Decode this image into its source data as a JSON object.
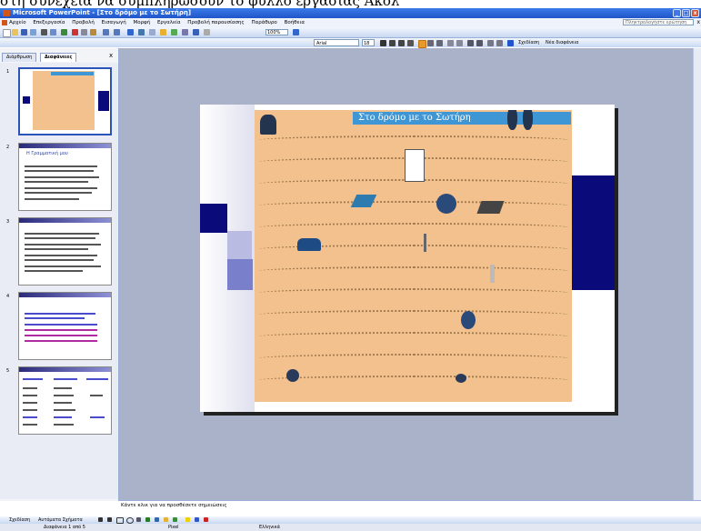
{
  "caption_text": "στη συνέχεια να συμπληρώσουν το φύλλο εργασίας Ακολ",
  "window": {
    "title": "Microsoft PowerPoint - [Στο δρόμο με το Σωτήρη]",
    "min": "_",
    "max": "□",
    "close": "x"
  },
  "menu": {
    "items": [
      "Αρχείο",
      "Επεξεργασία",
      "Προβολή",
      "Εισαγωγή",
      "Μορφή",
      "Εργαλεία",
      "Προβολή παρουσίασης",
      "Παράθυρο",
      "Βοήθεια"
    ],
    "help_placeholder": "Πληκτρολογήστε ερώτηση",
    "close_doc": "x"
  },
  "toolbar": {
    "zoom": "100%",
    "font": "Arial",
    "font_size": "18",
    "design_label": "Σχεδίαση",
    "new_slide_label": "Νέα διαφάνεια"
  },
  "panel": {
    "tab_outline": "Διάρθρωση",
    "tab_slides": "Διαφάνειες",
    "close": "x",
    "slide_numbers": [
      "1",
      "2",
      "3",
      "4",
      "5"
    ],
    "slide2_title": "Η Γραμματική μου"
  },
  "slide": {
    "poster_title": "Στο δρόμο με το Σωτήρη"
  },
  "notes": {
    "placeholder": "Κάντε κλικ για να προσθέσετε σημειώσεις"
  },
  "drawing": {
    "draw_label": "Σχεδίαση",
    "autoshapes_label": "Αυτόματα Σχήματα"
  },
  "status": {
    "slide_info": "Διαφάνεια 1 από 5",
    "design": "Pixel",
    "language": "Ελληνικά"
  },
  "colors": {
    "titlebar": "#2b62d6",
    "poster_bg": "#f2c18e",
    "poster_header": "#3f96d4",
    "accent_navy": "#0a0a7a"
  }
}
